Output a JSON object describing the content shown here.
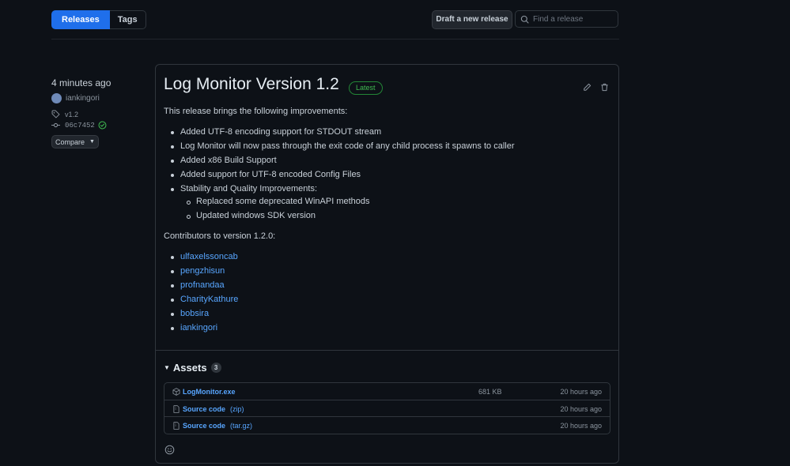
{
  "nav": {
    "tabs": [
      {
        "label": "Releases",
        "active": true
      },
      {
        "label": "Tags",
        "active": false
      }
    ],
    "draft_button": "Draft a new release",
    "search_placeholder": "Find a release"
  },
  "sidebar": {
    "time": "4 minutes ago",
    "author": "iankingori",
    "tag": "v1.2",
    "commit": "06c7452",
    "compare_button": "Compare"
  },
  "release": {
    "title": "Log Monitor Version 1.2",
    "badge": "Latest",
    "intro": "This release brings the following improvements:",
    "improvements": [
      "Added UTF-8 encoding support for STDOUT stream",
      "Log Monitor will now pass through the exit code of any child process it spawns to caller",
      "Added x86 Build Support",
      "Added support for UTF-8 encoded Config Files",
      "Stability and Quality Improvements:"
    ],
    "sub_improvements": [
      "Replaced some deprecated WinAPI methods",
      "Updated windows SDK version"
    ],
    "contributors_heading": "Contributors to version 1.2.0:",
    "contributors": [
      "ulfaxelssoncab",
      "pengzhisun",
      "profnandaa",
      "CharityKathure",
      "bobsira",
      "iankingori"
    ]
  },
  "assets": {
    "heading": "Assets",
    "count": "3",
    "items": [
      {
        "name": "LogMonitor.exe",
        "suffix": "",
        "size": "681 KB",
        "time": "20 hours ago"
      },
      {
        "name": "Source code",
        "suffix": "(zip)",
        "size": "",
        "time": "20 hours ago"
      },
      {
        "name": "Source code",
        "suffix": "(tar.gz)",
        "size": "",
        "time": "20 hours ago"
      }
    ]
  },
  "colors": {
    "background": "#0d1117",
    "accent": "#1f6feb",
    "link": "#58a6ff",
    "success": "#3fb950",
    "border": "#30363d"
  }
}
